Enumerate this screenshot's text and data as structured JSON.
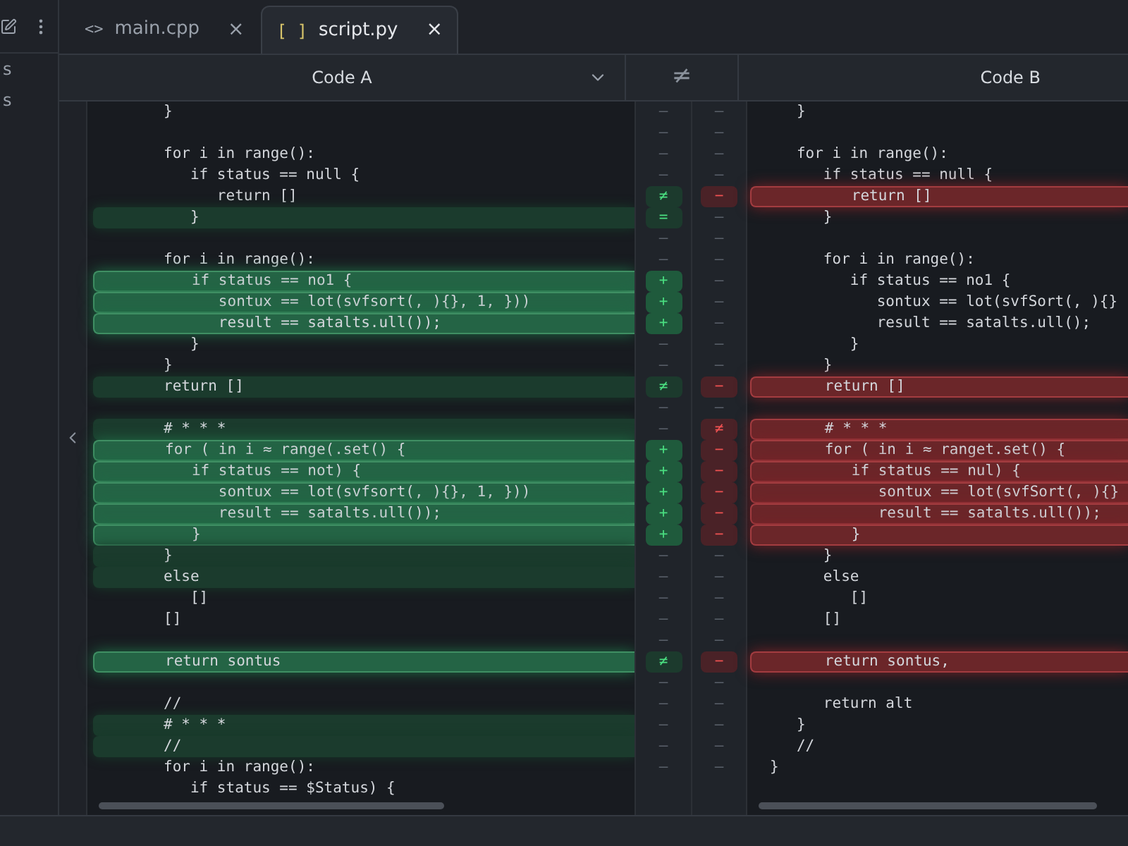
{
  "sidebar": {
    "items": [
      {
        "label": "s"
      },
      {
        "label": "s"
      }
    ]
  },
  "tabs": [
    {
      "icon": "<>",
      "label": "main.cpp",
      "close": "×",
      "selected": false
    },
    {
      "icon": "[ ]",
      "label": "script.py",
      "close": "×",
      "selected": true
    }
  ],
  "header": {
    "left_title": "Code A",
    "middle_symbol": "≠",
    "right_title": "Code B"
  },
  "rows": [
    {
      "a": {
        "text": "}",
        "kind": "plain"
      },
      "ma": {
        "symbol": "—",
        "kind": "same"
      },
      "mb": {
        "symbol": "—",
        "kind": "same"
      },
      "b": {
        "text": "   }",
        "kind": "plain"
      }
    },
    {
      "ma": {
        "symbol": "—",
        "kind": "same"
      },
      "mb": {
        "symbol": "—",
        "kind": "same"
      }
    },
    {
      "a": {
        "text": "for i in range():",
        "kind": "plain"
      },
      "ma": {
        "symbol": "—",
        "kind": "same"
      },
      "mb": {
        "symbol": "—",
        "kind": "same"
      },
      "b": {
        "text": "   for i in range():",
        "kind": "plain"
      }
    },
    {
      "a": {
        "text": "   if status == null {",
        "kind": "plain"
      },
      "ma": {
        "symbol": "—",
        "kind": "same"
      },
      "mb": {
        "symbol": "—",
        "kind": "same"
      },
      "b": {
        "text": "      if status == null {",
        "kind": "plain"
      }
    },
    {
      "a": {
        "text": "      return []",
        "kind": "plain"
      },
      "ma": {
        "symbol": "≠",
        "kind": "changed"
      },
      "mb": {
        "symbol": "−",
        "kind": "changed"
      },
      "b": {
        "text": "         return []",
        "kind": "removed"
      }
    },
    {
      "a": {
        "text": "   }",
        "kind": "faint"
      },
      "ma": {
        "symbol": "=",
        "kind": "changed"
      },
      "mb": {
        "symbol": "—",
        "kind": "same"
      },
      "b": {
        "text": "      }",
        "kind": "plain"
      }
    },
    {
      "ma": {
        "symbol": "—",
        "kind": "same"
      },
      "mb": {
        "symbol": "—",
        "kind": "same"
      }
    },
    {
      "a": {
        "text": "for i in range():",
        "kind": "plain"
      },
      "ma": {
        "symbol": "—",
        "kind": "same"
      },
      "mb": {
        "symbol": "—",
        "kind": "same"
      },
      "b": {
        "text": "      for i in range():",
        "kind": "plain"
      }
    },
    {
      "a": {
        "text": "   if status == no1 {",
        "kind": "added"
      },
      "ma": {
        "symbol": "+",
        "kind": "added"
      },
      "mb": {
        "symbol": "—",
        "kind": "same"
      },
      "b": {
        "text": "         if status == no1 {",
        "kind": "plain"
      }
    },
    {
      "a": {
        "text": "      sontux == lot(svfsort(, ){}, 1, }))",
        "kind": "added"
      },
      "ma": {
        "symbol": "+",
        "kind": "added"
      },
      "mb": {
        "symbol": "—",
        "kind": "same"
      },
      "b": {
        "text": "            sontux == lot(svfSort(, ){}",
        "kind": "plain"
      }
    },
    {
      "a": {
        "text": "      result == satalts.ull());",
        "kind": "added"
      },
      "ma": {
        "symbol": "+",
        "kind": "added"
      },
      "mb": {
        "symbol": "—",
        "kind": "same"
      },
      "b": {
        "text": "            result == satalts.ull();",
        "kind": "plain"
      }
    },
    {
      "a": {
        "text": "   }",
        "kind": "plain"
      },
      "ma": {
        "symbol": "—",
        "kind": "same"
      },
      "mb": {
        "symbol": "—",
        "kind": "same"
      },
      "b": {
        "text": "         }",
        "kind": "plain"
      }
    },
    {
      "a": {
        "text": "}",
        "kind": "plain"
      },
      "ma": {
        "symbol": "—",
        "kind": "same"
      },
      "mb": {
        "symbol": "—",
        "kind": "same"
      },
      "b": {
        "text": "      }",
        "kind": "plain"
      }
    },
    {
      "a": {
        "text": "return []",
        "kind": "faint"
      },
      "ma": {
        "symbol": "≠",
        "kind": "changed"
      },
      "mb": {
        "symbol": "−",
        "kind": "changed"
      },
      "b": {
        "text": "      return []",
        "kind": "removed"
      }
    },
    {
      "ma": {
        "symbol": "—",
        "kind": "same"
      },
      "mb": {
        "symbol": "—",
        "kind": "same"
      }
    },
    {
      "a": {
        "text": "# * * *",
        "kind": "faint"
      },
      "ma": {
        "symbol": "—",
        "kind": "same"
      },
      "mb": {
        "symbol": "≠",
        "kind": "changed"
      },
      "b": {
        "text": "      # * * *",
        "kind": "removed"
      }
    },
    {
      "a": {
        "text": "for ( in i ≈ range(.set() {",
        "kind": "added"
      },
      "ma": {
        "symbol": "+",
        "kind": "added"
      },
      "mb": {
        "symbol": "−",
        "kind": "changed"
      },
      "b": {
        "text": "      for ( in i ≈ ranget.set() {",
        "kind": "removed"
      }
    },
    {
      "a": {
        "text": "   if status == not) {",
        "kind": "added"
      },
      "ma": {
        "symbol": "+",
        "kind": "added"
      },
      "mb": {
        "symbol": "−",
        "kind": "changed"
      },
      "b": {
        "text": "         if status == nul) {",
        "kind": "removed"
      }
    },
    {
      "a": {
        "text": "      sontux == lot(svfsort(, ){}, 1, }))",
        "kind": "added"
      },
      "ma": {
        "symbol": "+",
        "kind": "added"
      },
      "mb": {
        "symbol": "−",
        "kind": "changed"
      },
      "b": {
        "text": "            sontux == lot(svfSort(, ){}",
        "kind": "removed"
      }
    },
    {
      "a": {
        "text": "      result == satalts.ull());",
        "kind": "added"
      },
      "ma": {
        "symbol": "+",
        "kind": "added"
      },
      "mb": {
        "symbol": "−",
        "kind": "changed"
      },
      "b": {
        "text": "            result == satalts.ull());",
        "kind": "removed"
      }
    },
    {
      "a": {
        "text": "   }",
        "kind": "added"
      },
      "ma": {
        "symbol": "+",
        "kind": "added"
      },
      "mb": {
        "symbol": "−",
        "kind": "changed"
      },
      "b": {
        "text": "         }",
        "kind": "removed"
      }
    },
    {
      "a": {
        "text": "}",
        "kind": "faint"
      },
      "ma": {
        "symbol": "—",
        "kind": "same"
      },
      "mb": {
        "symbol": "—",
        "kind": "same"
      },
      "b": {
        "text": "      }",
        "kind": "plain"
      }
    },
    {
      "a": {
        "text": "else",
        "kind": "faint"
      },
      "ma": {
        "symbol": "—",
        "kind": "same"
      },
      "mb": {
        "symbol": "—",
        "kind": "same"
      },
      "b": {
        "text": "      else",
        "kind": "plain"
      }
    },
    {
      "a": {
        "text": "   []",
        "kind": "plain"
      },
      "ma": {
        "symbol": "—",
        "kind": "same"
      },
      "mb": {
        "symbol": "—",
        "kind": "same"
      },
      "b": {
        "text": "         []",
        "kind": "plain"
      }
    },
    {
      "a": {
        "text": "[]",
        "kind": "plain"
      },
      "ma": {
        "symbol": "—",
        "kind": "same"
      },
      "mb": {
        "symbol": "—",
        "kind": "same"
      },
      "b": {
        "text": "      []",
        "kind": "plain"
      }
    },
    {
      "ma": {
        "symbol": "—",
        "kind": "same"
      },
      "mb": {
        "symbol": "—",
        "kind": "same"
      }
    },
    {
      "a": {
        "text": "return sontus",
        "kind": "added"
      },
      "ma": {
        "symbol": "≠",
        "kind": "changed"
      },
      "mb": {
        "symbol": "−",
        "kind": "changed"
      },
      "b": {
        "text": "      return sontus,",
        "kind": "removed"
      }
    },
    {
      "ma": {
        "symbol": "—",
        "kind": "same"
      },
      "mb": {
        "symbol": "—",
        "kind": "same"
      }
    },
    {
      "a": {
        "text": "//",
        "kind": "plain"
      },
      "ma": {
        "symbol": "—",
        "kind": "same"
      },
      "mb": {
        "symbol": "—",
        "kind": "same"
      },
      "b": {
        "text": "      return alt",
        "kind": "plain"
      }
    },
    {
      "a": {
        "text": "# * * *",
        "kind": "faint"
      },
      "ma": {
        "symbol": "—",
        "kind": "same"
      },
      "mb": {
        "symbol": "—",
        "kind": "same"
      },
      "b": {
        "text": "   }",
        "kind": "plain"
      }
    },
    {
      "a": {
        "text": "//",
        "kind": "faint"
      },
      "ma": {
        "symbol": "—",
        "kind": "same"
      },
      "mb": {
        "symbol": "—",
        "kind": "same"
      },
      "b": {
        "text": "   //",
        "kind": "plain"
      }
    },
    {
      "a": {
        "text": "for i in range():",
        "kind": "plain"
      },
      "ma": {
        "symbol": "—",
        "kind": "same"
      },
      "mb": {
        "symbol": "—",
        "kind": "same"
      },
      "b": {
        "text": "}",
        "kind": "plain"
      }
    },
    {
      "a": {
        "text": "   if status == $Status) {",
        "kind": "plain"
      }
    }
  ]
}
